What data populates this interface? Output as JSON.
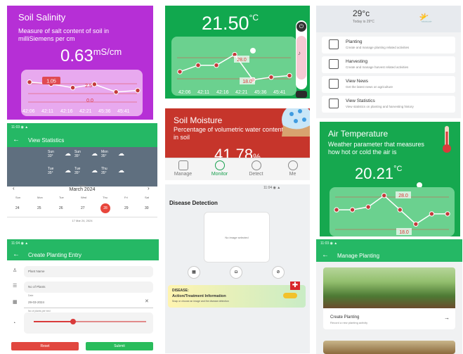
{
  "colors": {
    "salinity_bg": "#b62fd6",
    "green_primary": "#16a84f",
    "moisture_bg": "#c6352b",
    "point_fill": "#c33a3a",
    "chart_line": "#ffffff"
  },
  "salinity": {
    "title": "Soil Salinity",
    "description": "Measure of salt content of soil in milliSiemens per cm",
    "value": "0.63",
    "unit": "mS/cm",
    "labels": [
      "1.05",
      "2.5",
      "0.0"
    ],
    "times": [
      "42:06",
      "42:11",
      "42:16",
      "42:21",
      "45:36",
      "45:41"
    ],
    "series": [
      0.78,
      0.72,
      0.6,
      0.71,
      0.46,
      0.51
    ]
  },
  "temp_top": {
    "value": "21.50",
    "unit": "°C",
    "labels": [
      "28.0",
      "18.0"
    ],
    "times": [
      "42:06",
      "42:11",
      "42:16",
      "42:21",
      "45:36",
      "45:41"
    ],
    "series": [
      0.35,
      0.55,
      0.55,
      0.88,
      0.1,
      0.18,
      0.23
    ]
  },
  "moisture": {
    "title": "Soil Moisture",
    "description": "Percentage of volumetric water content in soil",
    "value": "41.78",
    "unit": "%"
  },
  "bottom_nav": [
    "Manage",
    "Monitor",
    "Detect",
    "Me"
  ],
  "weather": {
    "temp": "29°c",
    "sub": "Today is 29°C"
  },
  "menu": [
    {
      "title": "Planting",
      "sub": "Create and manage planting related activities"
    },
    {
      "title": "Harvesting",
      "sub": "Create and manage harvest related activities"
    },
    {
      "title": "View News",
      "sub": "Get the latest news on agriculture"
    },
    {
      "title": "View Statistics",
      "sub": "View statistics on planting and harvesting history"
    }
  ],
  "view_statistics": {
    "status": "11:03 ◉ ▲",
    "title": "View Statistics",
    "weather_days": [
      {
        "day": "Sun",
        "temp": "33°"
      },
      {
        "day": "Sun",
        "temp": "35°"
      },
      {
        "day": "Mon",
        "temp": "35°"
      },
      {
        "day": "Tue",
        "temp": "35°"
      },
      {
        "day": "Tue",
        "temp": "35°"
      },
      {
        "day": "Thu",
        "temp": "35°"
      }
    ],
    "month": "March 2024",
    "month_sub": "Today",
    "weekdays": [
      "Sun",
      "Mon",
      "Tue",
      "Wed",
      "Thu",
      "Fri",
      "Sat"
    ],
    "dates": [
      "24",
      "25",
      "26",
      "27",
      "28",
      "29",
      "30"
    ],
    "selected_index": 4,
    "footer": "17 Mar 24, 2024"
  },
  "disease": {
    "status": "11:04 ◉ ▲",
    "title": "Disease Detection",
    "placeholder": "No image selected",
    "label": "DISEASE:",
    "name": "Action/Treatment Information",
    "hint": "Snap or choose an image and the disease detection"
  },
  "air_temp": {
    "title": "Air Temperature",
    "description": "Weather parameter that measures how hot or cold the air is",
    "value": "20.21",
    "unit": "°C",
    "labels": [
      "28.0",
      "18.0"
    ],
    "series": [
      0.55,
      0.55,
      0.62,
      0.9,
      0.55,
      0.2,
      0.45,
      0.45
    ]
  },
  "create_planting": {
    "status": "11:04 ◉ ▲",
    "title": "Create Planting Entry",
    "fields": [
      "Plant Name",
      "No of Plants",
      "29-03-2024",
      "No of plants per bed"
    ],
    "date_label": "Date",
    "buttons": [
      "Reset",
      "Submit"
    ]
  },
  "manage_planting": {
    "status": "11:03 ◉ ▲",
    "title": "Manage Planting",
    "card_title": "Create Planting",
    "card_sub": "Record a new planting activity"
  }
}
